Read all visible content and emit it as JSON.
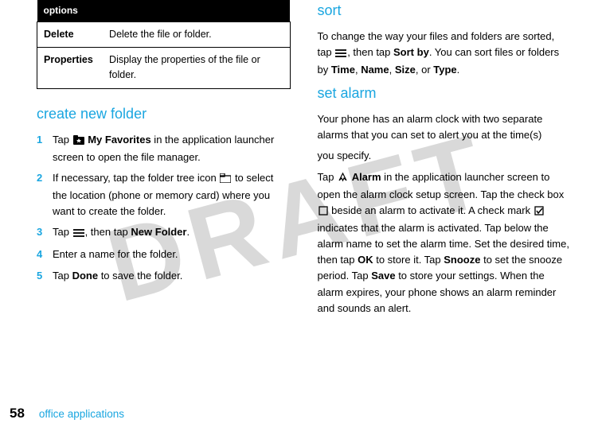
{
  "watermark": "DRAFT",
  "left": {
    "table": {
      "header": "options",
      "rows": [
        {
          "label": "Delete",
          "desc": "Delete the file or folder."
        },
        {
          "label": "Properties",
          "desc": "Display the properties of the file or folder."
        }
      ]
    },
    "heading_create": "create new folder",
    "steps": [
      {
        "n": "1",
        "pre": "Tap ",
        "strong": "My Favorites",
        "post": " in the application launcher screen to open the file manager.",
        "icon": "folder-fav"
      },
      {
        "n": "2",
        "pre": "If necessary, tap the folder tree icon ",
        "strong": "",
        "post": " to select the location (phone or memory card) where you want to create the folder.",
        "icon": "folder-tree"
      },
      {
        "n": "3",
        "pre": "Tap ",
        "strong": "New Folder",
        "post": ".",
        "icon": "menu",
        "mid": ", then tap "
      },
      {
        "n": "4",
        "pre": "Enter a name for the folder.",
        "strong": "",
        "post": ""
      },
      {
        "n": "5",
        "pre": "Tap ",
        "strong": "Done",
        "post": " to save the folder."
      }
    ]
  },
  "right": {
    "heading_sort": "sort",
    "sort_p1a": "To change the way your files and folders are sorted, tap ",
    "sort_p1b": ", then tap ",
    "sort_sortby": "Sort by",
    "sort_p1c": ". You can sort files or folders by ",
    "sort_time": "Time",
    "sort_name": "Name",
    "sort_size": "Size",
    "sort_or": ", or ",
    "sort_type": "Type",
    "sort_end": ".",
    "heading_alarm": "set alarm",
    "alarm_p2": "Your phone has an alarm clock with two separate alarms that you can set to alert you at the time(s)",
    "alarm_p2b": "you specify.",
    "alarm_p3a": "Tap ",
    "alarm_strong": "Alarm",
    "alarm_p3b": " in the application launcher screen to open the alarm clock setup screen. Tap the check box ",
    "alarm_p3c": " beside an alarm to activate it. A check mark ",
    "alarm_p3d": " indicates that the alarm is activated. Tap below the alarm name to set the alarm time. Set the desired time, then tap ",
    "alarm_ok": "OK",
    "alarm_p3e": " to store it. Tap ",
    "alarm_snooze": "Snooze",
    "alarm_p3f": " to set the snooze period. Tap ",
    "alarm_save": "Save",
    "alarm_p3g": " to store your settings. When the alarm expires, your phone shows an alarm reminder and sounds an alert."
  },
  "footer": {
    "page": "58",
    "section": "office applications"
  }
}
